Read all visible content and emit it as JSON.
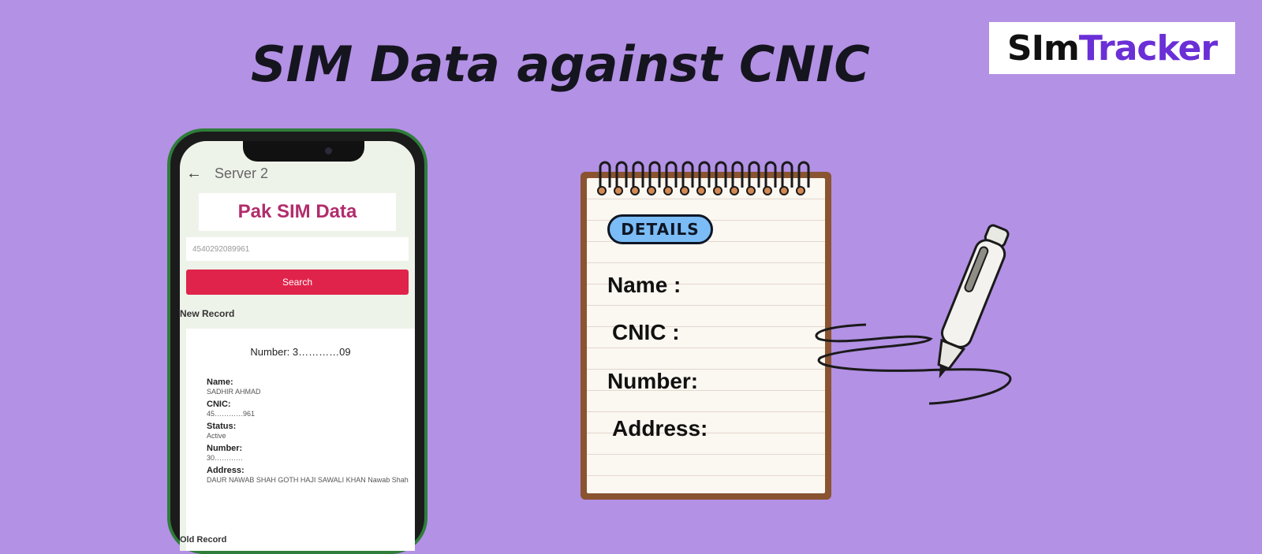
{
  "headline": "SIM Data against CNIC",
  "logo": {
    "part1": "SIm",
    "part2": "Tracker"
  },
  "phone": {
    "appbar_title": "Server 2",
    "brand": "Pak SIM Data",
    "cnic_input_value": "4540292089961",
    "search_label": "Search",
    "section_label": "New Record",
    "record": {
      "number_label": "Number: 3…………09",
      "name_label": "Name:",
      "name_value": "SADHIR AHMAD",
      "cnic_label": "CNIC:",
      "cnic_value": "45…………961",
      "status_label": "Status:",
      "status_value": "Active",
      "number_field_label": "Number:",
      "number_field_value": "30…………",
      "address_label": "Address:",
      "address_value": "DAUR NAWAB SHAH GOTH HAJI SAWALI KHAN Nawab Shah"
    },
    "footer_label": "Old Record"
  },
  "notepad": {
    "badge": "DETAILS",
    "name_label": "Name :",
    "cnic_label": "CNIC :",
    "number_label": "Number:",
    "address_label": "Address:"
  },
  "colors": {
    "background": "#b391e5",
    "logo_accent": "#6a2fd6",
    "search_button": "#e0234a",
    "brand_text": "#b12d6c",
    "notepad_frame": "#8a5431",
    "badge": "#7bbcf6"
  }
}
